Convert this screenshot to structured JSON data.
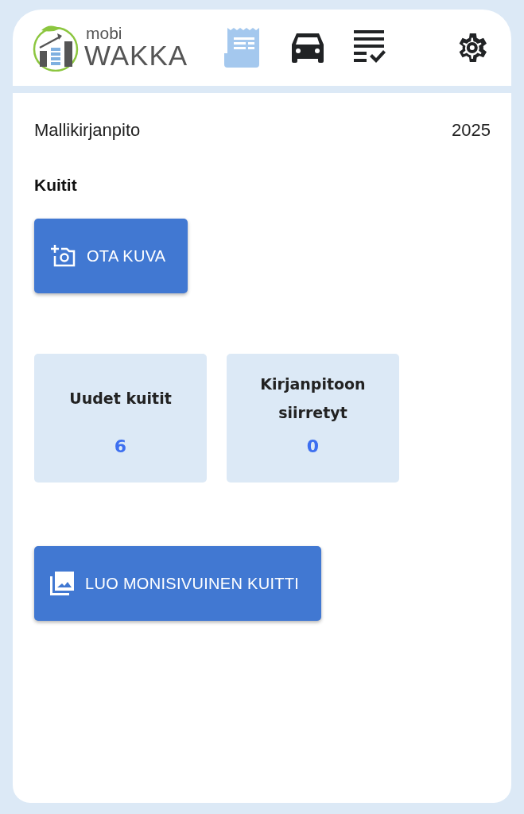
{
  "logo": {
    "small": "mobi",
    "large": "WAKKA"
  },
  "nav": [
    {
      "kind": "receipt",
      "selected": true
    },
    {
      "kind": "car",
      "selected": false
    },
    {
      "kind": "checklist",
      "selected": false
    },
    {
      "kind": "settings",
      "selected": false
    }
  ],
  "company": "Mallikirjanpito",
  "year": "2025",
  "section_title": "Kuitit",
  "buttons": [
    {
      "kind": "camera",
      "label": "OTA KUVA"
    },
    {
      "kind": "gallery",
      "label": "LUO MONISIVUINEN KUITTI"
    }
  ],
  "stats": [
    {
      "label": "Uudet kuitit",
      "value": "6"
    },
    {
      "label": "Kirjanpitoon siirretyt",
      "value": "0"
    }
  ]
}
